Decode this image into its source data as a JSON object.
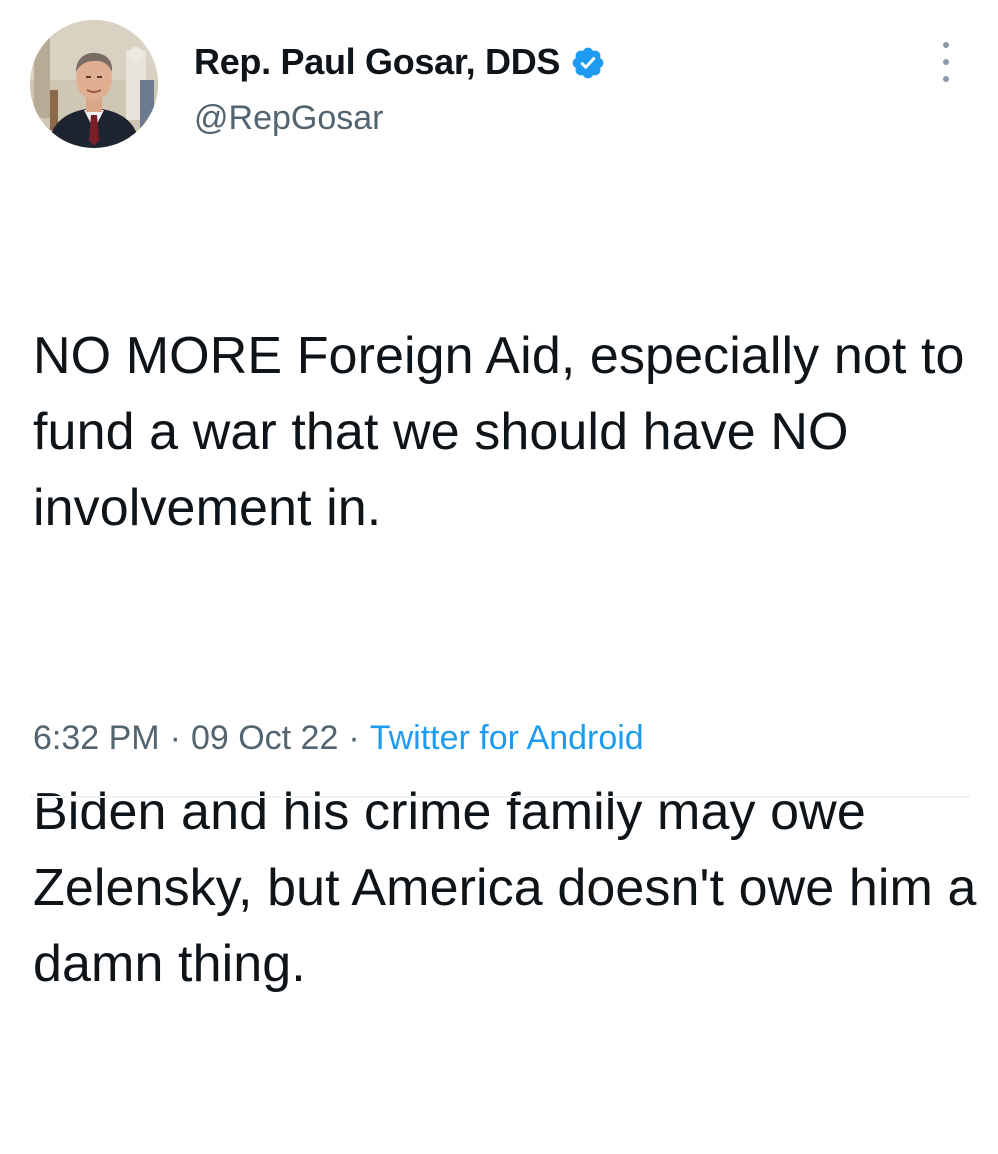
{
  "tweet": {
    "author": {
      "display_name": "Rep. Paul Gosar, DDS",
      "handle": "@RepGosar",
      "verified": true
    },
    "text": {
      "paragraph_1": "NO MORE Foreign Aid, especially not to fund a war that we should have NO involvement in.",
      "paragraph_2": "Biden and his crime family may owe Zelensky, but America doesn't owe him a damn thing."
    },
    "meta": {
      "time": "6:32 PM",
      "date": "09 Oct 22",
      "separator": "·",
      "source": "Twitter for Android"
    }
  },
  "icons": {
    "verified": "verified-badge-icon",
    "more": "more-options-icon"
  },
  "colors": {
    "text_primary": "#0f1419",
    "text_secondary": "#536471",
    "link_blue": "#1d9bf0",
    "verified_blue": "#1d9bf0"
  }
}
